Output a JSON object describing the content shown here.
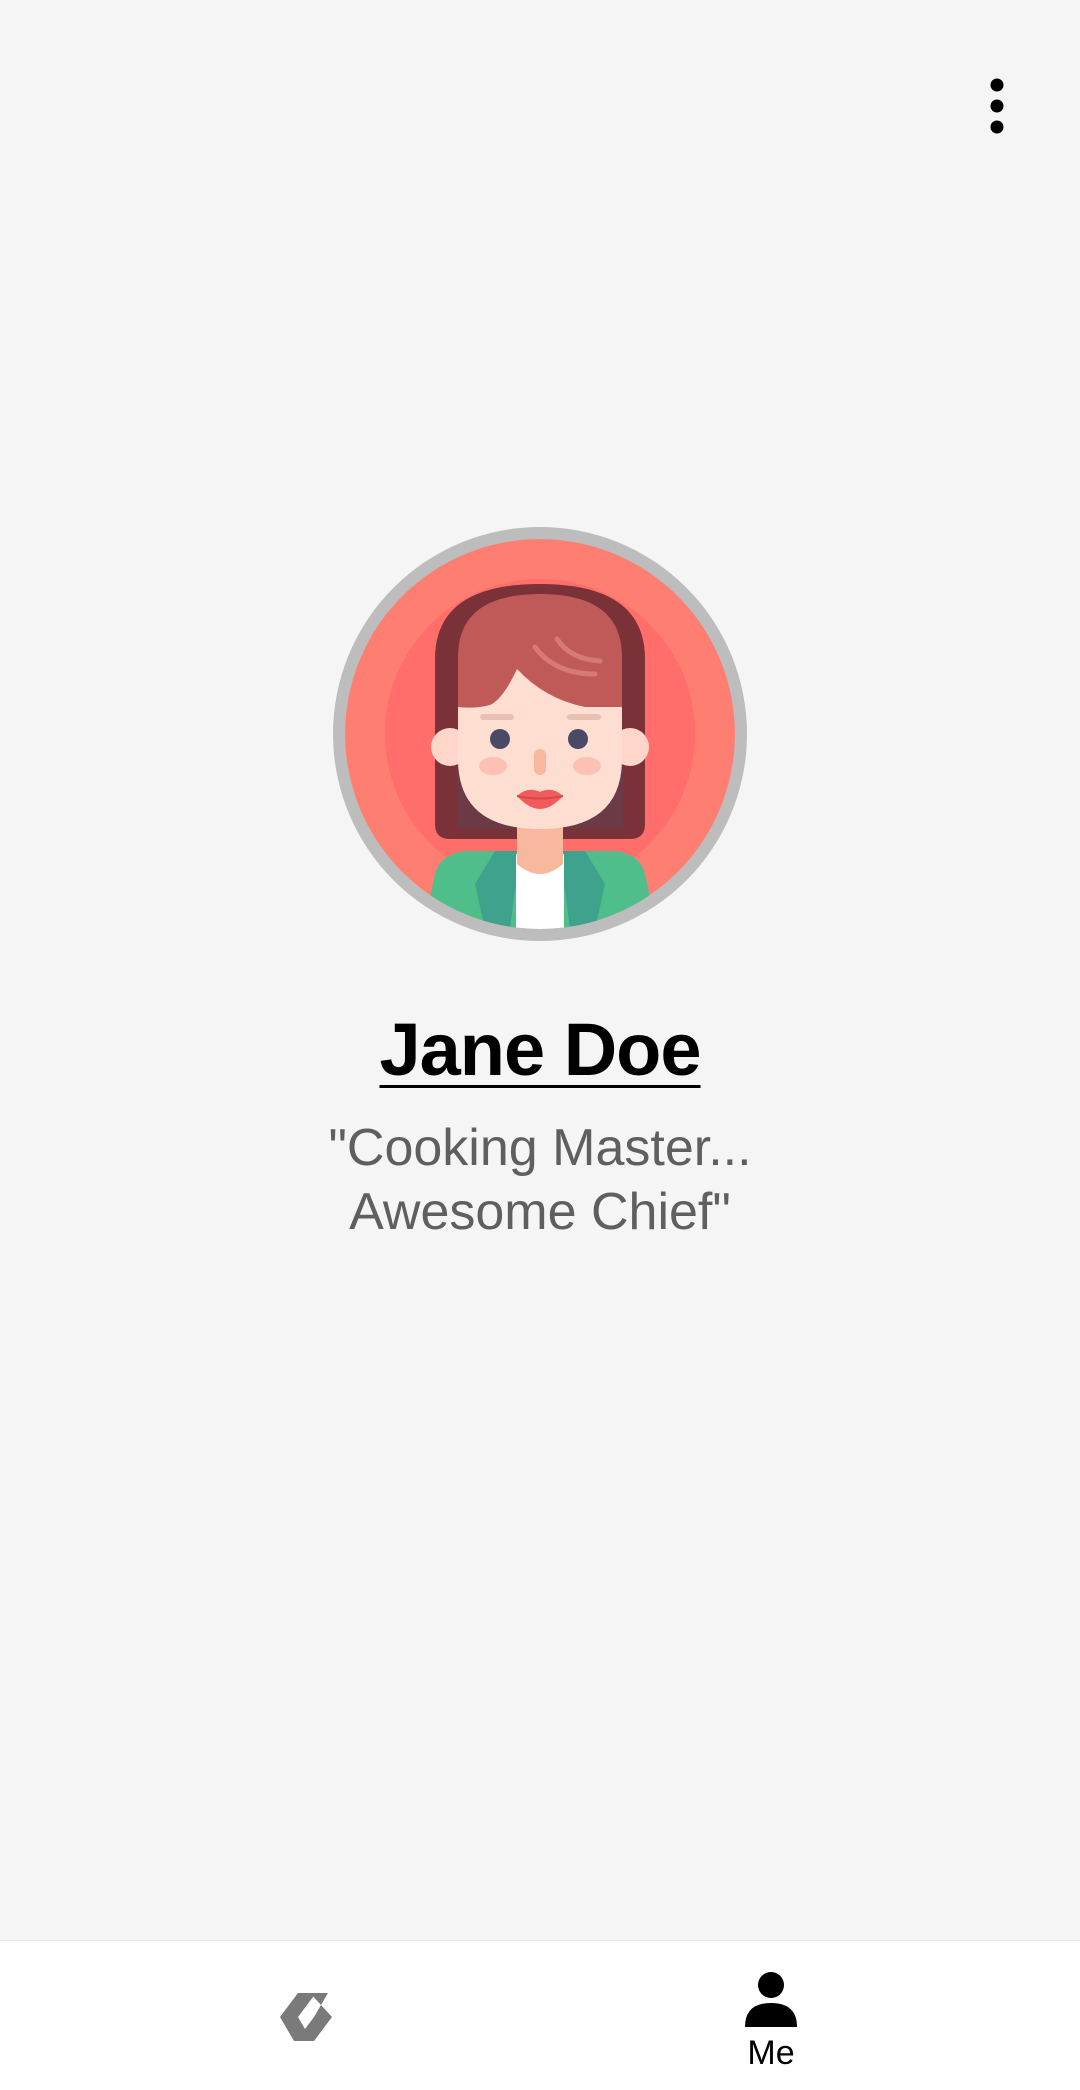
{
  "header": {
    "menu_icon": "more-vert-icon"
  },
  "profile": {
    "name": "Jane Doe",
    "bio_line1": "\"Cooking Master...",
    "bio_line2": "Awesome Chief\"",
    "avatar": "woman-avatar-illustration"
  },
  "bottom_nav": {
    "items": [
      {
        "icon": "app-logo-icon",
        "label": ""
      },
      {
        "icon": "person-icon",
        "label": "Me"
      }
    ]
  },
  "colors": {
    "background": "#f5f5f5",
    "avatar_ring": "#bdbdbd",
    "avatar_bg": "#ff7e72",
    "nav_background": "#ffffff"
  }
}
